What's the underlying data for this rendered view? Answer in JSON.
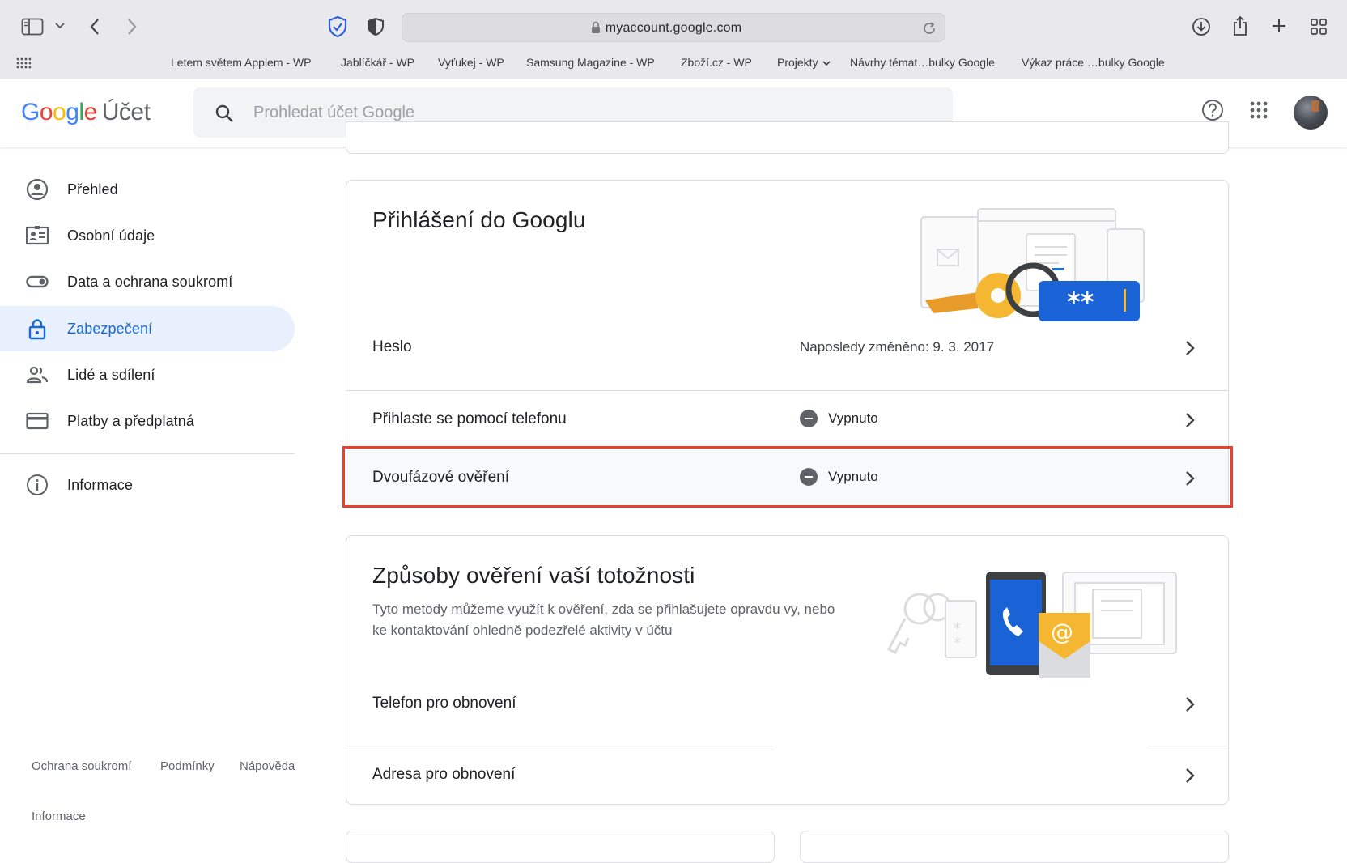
{
  "browser": {
    "url": "myaccount.google.com",
    "bookmarks": [
      "Letem světem Applem - WP",
      "Jablíčkář - WP",
      "Vyťukej - WP",
      "Samsung Magazine - WP",
      "Zboží.cz - WP",
      "Projekty",
      "Návrhy témat…bulky Google",
      "Výkaz práce …bulky Google"
    ]
  },
  "header": {
    "logo_word": "Google",
    "logo_suffix": "Účet",
    "search_placeholder": "Prohledat účet Google"
  },
  "sidebar": {
    "items": [
      {
        "label": "Přehled",
        "icon": "account-circle-icon"
      },
      {
        "label": "Osobní údaje",
        "icon": "id-card-icon"
      },
      {
        "label": "Data a ochrana soukromí",
        "icon": "toggle-icon"
      },
      {
        "label": "Zabezpečení",
        "icon": "lock-icon",
        "active": true
      },
      {
        "label": "Lidé a sdílení",
        "icon": "people-icon"
      },
      {
        "label": "Platby a předplatná",
        "icon": "credit-card-icon"
      },
      {
        "label": "Informace",
        "icon": "info-icon"
      }
    ],
    "footer": {
      "privacy": "Ochrana soukromí",
      "terms": "Podmínky",
      "help": "Nápověda",
      "about": "Informace"
    }
  },
  "signin_card": {
    "title": "Přihlášení do Googlu",
    "rows": [
      {
        "label": "Heslo",
        "value": "Naposledy změněno: 9. 3. 2017"
      },
      {
        "label": "Přihlaste se pomocí telefonu",
        "status": "Vypnuto"
      },
      {
        "label": "Dvoufázové ověření",
        "status": "Vypnuto"
      }
    ]
  },
  "verify_card": {
    "title": "Způsoby ověření vaší totožnosti",
    "description": "Tyto metody můžeme využít k ověření, zda se přihlašujete opravdu vy, nebo ke kontaktování ohledně podezřelé aktivity v účtu",
    "rows": [
      {
        "label": "Telefon pro obnovení"
      },
      {
        "label": "Adresa pro obnovení"
      }
    ]
  },
  "colors": {
    "accent": "#1967d2",
    "active_bg": "#e8f0fe",
    "highlight": "#e8412f"
  }
}
